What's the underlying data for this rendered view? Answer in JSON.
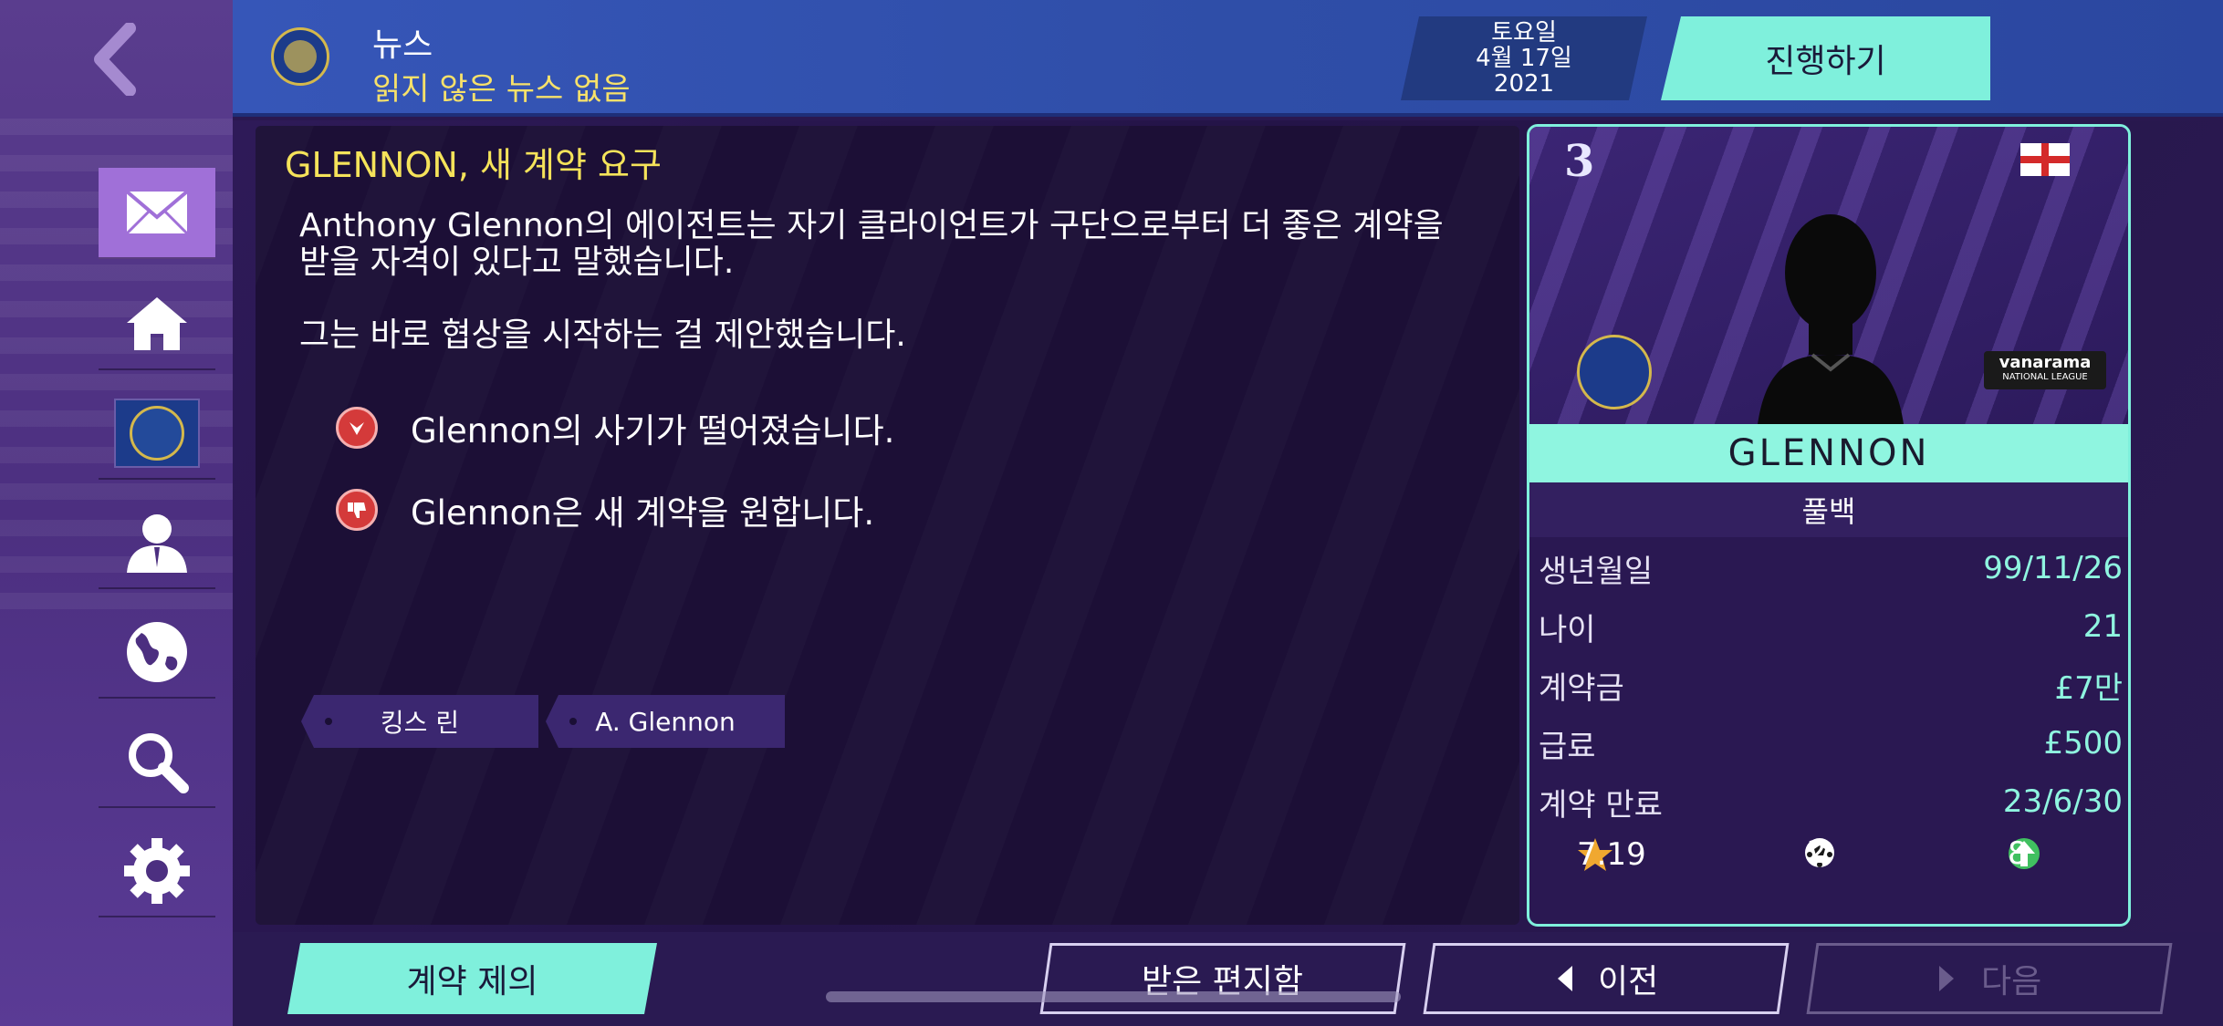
{
  "header": {
    "title": "뉴스",
    "subtitle": "읽지 않은 뉴스 없음",
    "date": {
      "day": "토요일",
      "date": "4월 17일",
      "year": "2021"
    },
    "continue_label": "진행하기"
  },
  "sidebar": {
    "items": [
      {
        "name": "mail",
        "icon": "envelope-icon",
        "active": true
      },
      {
        "name": "home",
        "icon": "home-icon"
      },
      {
        "name": "club",
        "icon": "club-badge-icon"
      },
      {
        "name": "manager",
        "icon": "person-icon"
      },
      {
        "name": "world",
        "icon": "globe-icon"
      },
      {
        "name": "search",
        "icon": "search-icon"
      },
      {
        "name": "settings",
        "icon": "gear-icon"
      }
    ]
  },
  "message": {
    "title": "GLENNON, 새 계약 요구",
    "paragraph1": "Anthony Glennon의 에이전트는 자기 클라이언트가 구단으로부터 더 좋은 계약을 받을 자격이 있다고 말했습니다.",
    "paragraph2": "그는 바로 협상을 시작하는 걸 제안했습니다.",
    "bullets": [
      {
        "icon": "morale-down-icon",
        "text": "Glennon의 사기가 떨어졌습니다."
      },
      {
        "icon": "thumbs-down-icon",
        "text": "Glennon은 새 계약을 원합니다."
      }
    ],
    "tags": [
      "킹스 린",
      "A. Glennon"
    ]
  },
  "player": {
    "shirt_number": "3",
    "nationality_flag": "england-flag-icon",
    "league_badge": {
      "name": "vanarama",
      "sub": "NATIONAL LEAGUE"
    },
    "name": "GLENNON",
    "position": "풀백",
    "stats": [
      {
        "label": "생년월일",
        "value": "99/11/26"
      },
      {
        "label": "나이",
        "value": "21"
      },
      {
        "label": "계약금",
        "value": "£7만"
      },
      {
        "label": "급료",
        "value": "£500"
      },
      {
        "label": "계약 만료",
        "value": "23/6/30"
      }
    ],
    "rating": "7.19",
    "goals": "2",
    "assists": "8"
  },
  "bottom": {
    "offer_label": "계약 제의",
    "inbox_label": "받은 편지함",
    "prev_label": "이전",
    "next_label": "다음"
  },
  "colors": {
    "accent": "#7ff0dc",
    "header_blue": "#3656b8",
    "title_yellow": "#f5e35a",
    "stat_value": "#8ff5e0"
  }
}
